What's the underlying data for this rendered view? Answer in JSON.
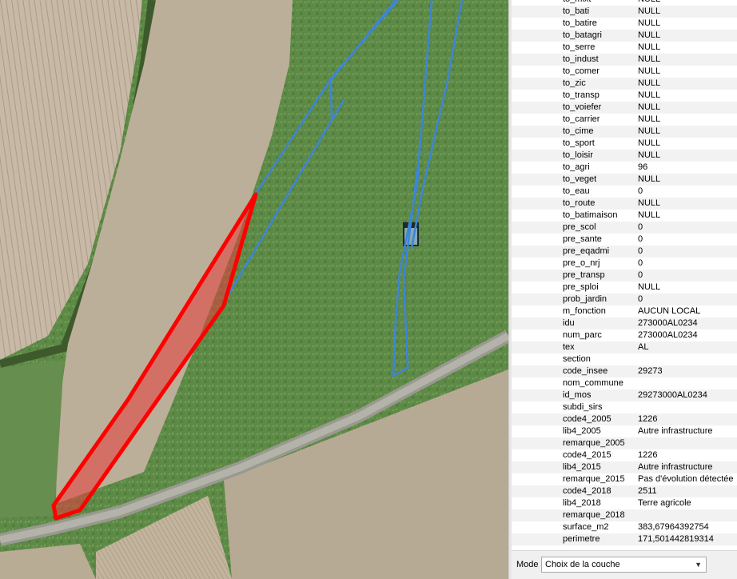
{
  "attributes": [
    {
      "field": "to_mixt",
      "value": "NULL"
    },
    {
      "field": "to_bati",
      "value": "NULL"
    },
    {
      "field": "to_batire",
      "value": "NULL"
    },
    {
      "field": "to_batagri",
      "value": "NULL"
    },
    {
      "field": "to_serre",
      "value": "NULL"
    },
    {
      "field": "to_indust",
      "value": "NULL"
    },
    {
      "field": "to_comer",
      "value": "NULL"
    },
    {
      "field": "to_zic",
      "value": "NULL"
    },
    {
      "field": "to_transp",
      "value": "NULL"
    },
    {
      "field": "to_voiefer",
      "value": "NULL"
    },
    {
      "field": "to_carrier",
      "value": "NULL"
    },
    {
      "field": "to_cime",
      "value": "NULL"
    },
    {
      "field": "to_sport",
      "value": "NULL"
    },
    {
      "field": "to_loisir",
      "value": "NULL"
    },
    {
      "field": "to_agri",
      "value": "96"
    },
    {
      "field": "to_veget",
      "value": "NULL"
    },
    {
      "field": "to_eau",
      "value": "0"
    },
    {
      "field": "to_route",
      "value": "NULL"
    },
    {
      "field": "to_batimaison",
      "value": "NULL"
    },
    {
      "field": "pre_scol",
      "value": "0"
    },
    {
      "field": "pre_sante",
      "value": "0"
    },
    {
      "field": "pre_eqadmi",
      "value": "0"
    },
    {
      "field": "pre_o_nrj",
      "value": "0"
    },
    {
      "field": "pre_transp",
      "value": "0"
    },
    {
      "field": "pre_sploi",
      "value": "NULL"
    },
    {
      "field": "prob_jardin",
      "value": "0"
    },
    {
      "field": "m_fonction",
      "value": "AUCUN LOCAL"
    },
    {
      "field": "idu",
      "value": "273000AL0234"
    },
    {
      "field": "num_parc",
      "value": "273000AL0234"
    },
    {
      "field": "tex",
      "value": "AL"
    },
    {
      "field": "section",
      "value": ""
    },
    {
      "field": "code_insee",
      "value": "29273"
    },
    {
      "field": "nom_commune",
      "value": ""
    },
    {
      "field": "id_mos",
      "value": "29273000AL0234"
    },
    {
      "field": "subdi_sirs",
      "value": ""
    },
    {
      "field": "code4_2005",
      "value": "1226"
    },
    {
      "field": "lib4_2005",
      "value": "Autre infrastructure"
    },
    {
      "field": "remarque_2005",
      "value": ""
    },
    {
      "field": "code4_2015",
      "value": "1226"
    },
    {
      "field": "lib4_2015",
      "value": "Autre infrastructure"
    },
    {
      "field": "remarque_2015",
      "value": "Pas d'évolution détectée"
    },
    {
      "field": "code4_2018",
      "value": "2511"
    },
    {
      "field": "lib4_2018",
      "value": "Terre agricole"
    },
    {
      "field": "remarque_2018",
      "value": ""
    },
    {
      "field": "surface_m2",
      "value": "383,67964392754"
    },
    {
      "field": "perimetre",
      "value": "171,501442819314"
    }
  ],
  "mode": {
    "label": "Mode",
    "selected": "Choix de la couche"
  },
  "colors": {
    "selection": "#ff0000",
    "outline": "#3d85d6",
    "road": "#9a9990"
  },
  "icons": {
    "dropdown": "chevron-down-icon"
  }
}
